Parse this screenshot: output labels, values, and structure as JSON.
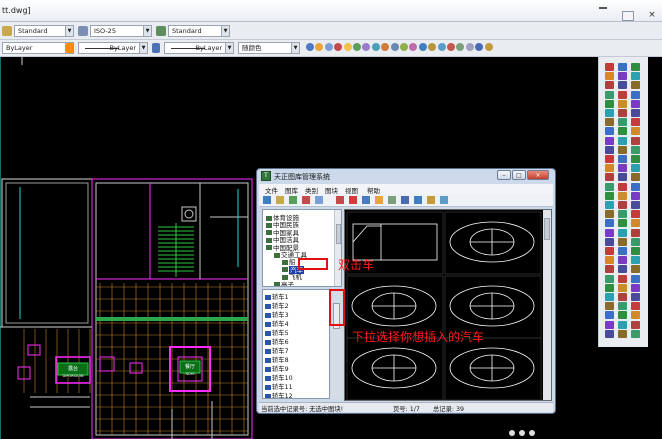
{
  "window": {
    "title": "tt.dwg]",
    "min_icon": "minimize-icon",
    "max_icon": "maximize-icon",
    "close_glyph": "×"
  },
  "toolbar1": {
    "text_style": "Standard",
    "dim_style": "ISO-25",
    "table_style": "Standard"
  },
  "toolbar2": {
    "layer": "ByLayer",
    "linetype_label": "ByLayer",
    "lineweight_label": "ByLayer",
    "plot_color": "随颜色"
  },
  "drawing": {
    "balcony_label": "露台",
    "balcony_sub": "DIPORIGUIN",
    "room_label": "餐厅",
    "room_sub": "NDHI"
  },
  "dialog": {
    "title": "天正图库管理系统",
    "menu": [
      "文件",
      "图库",
      "类别",
      "图块",
      "视图",
      "帮助"
    ],
    "tree": [
      {
        "label": "体育设施",
        "indent": 0
      },
      {
        "label": "中国民族",
        "indent": 0
      },
      {
        "label": "中国家具",
        "indent": 0
      },
      {
        "label": "中国洁具",
        "indent": 0
      },
      {
        "label": "中国配景",
        "indent": 0
      },
      {
        "label": "交通工具",
        "indent": 1
      },
      {
        "label": "船",
        "indent": 2
      },
      {
        "label": "汽车",
        "indent": 2,
        "selected": true
      },
      {
        "label": "飞机",
        "indent": 2
      },
      {
        "label": "亭子",
        "indent": 1
      }
    ],
    "list": [
      "轿车1",
      "轿车2",
      "轿车3",
      "轿车4",
      "轿车5",
      "轿车6",
      "轿车7",
      "轿车8",
      "轿车9",
      "轿车10",
      "轿车11",
      "轿车12"
    ],
    "status": {
      "current": "当前选中记录号: 无选中图块!",
      "page": "页号: 1/7",
      "total": "总记录: 39"
    }
  },
  "annotations": {
    "double_click": "双击车",
    "dropdown_hint": "下拉选择你想插入的汽车"
  },
  "colors": {
    "annotation": "#ff1a1a",
    "cad_background": "#000000",
    "wall_magenta": "#ff2bff",
    "grid_orange": "#c8832a",
    "dialog_frame": "#ccd9ea"
  }
}
